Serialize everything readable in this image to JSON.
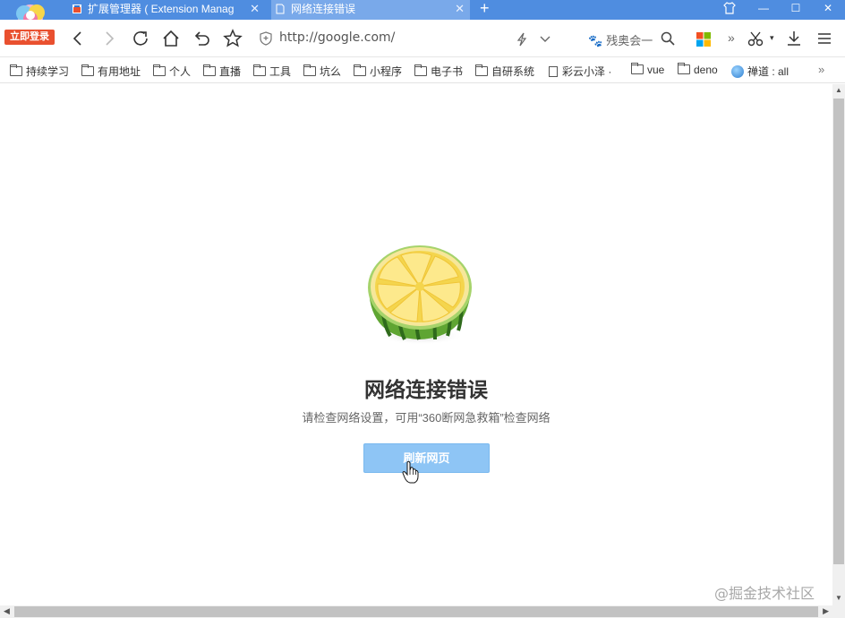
{
  "browser": {
    "login_badge": "立即登录",
    "tabs": [
      {
        "label": "扩展管理器 ( Extension Manag",
        "close": "✕"
      },
      {
        "label": "网络连接错误",
        "close": "✕"
      }
    ],
    "new_tab": "+",
    "window_buttons": {
      "minimize": "—",
      "maximize": "☐",
      "close": "✕"
    }
  },
  "navbar": {
    "address": "http://google.com/",
    "search_engine_text": "残奥会一",
    "more": "»",
    "scissors_drop": "▾"
  },
  "bookmarks": {
    "items": [
      {
        "label": "持续学习",
        "icon": "folder-icon"
      },
      {
        "label": "有用地址",
        "icon": "folder-icon"
      },
      {
        "label": "个人",
        "icon": "folder-icon"
      },
      {
        "label": "直播",
        "icon": "folder-icon"
      },
      {
        "label": "工具",
        "icon": "folder-icon"
      },
      {
        "label": "坑么",
        "icon": "folder-icon"
      },
      {
        "label": "小程序",
        "icon": "folder-icon"
      },
      {
        "label": "电子书",
        "icon": "folder-icon"
      },
      {
        "label": "自研系统",
        "icon": "folder-icon"
      },
      {
        "label": "彩云小泽 ·",
        "icon": "page-icon"
      },
      {
        "label": "vue",
        "icon": "folder-icon"
      },
      {
        "label": "deno",
        "icon": "folder-icon"
      },
      {
        "label": "禅道 : all",
        "icon": "globe-icon"
      }
    ],
    "more": "»"
  },
  "error_page": {
    "title": "网络连接错误",
    "description": "请检查网络设置，可用“360断网急救箱”检查网络",
    "refresh_button": "刷新网页"
  },
  "watermark": "@掘金技术社区",
  "colors": {
    "titlebar": "#4f8de0",
    "active_tab": "#79a9ea",
    "login_badge": "#e9502f",
    "refresh_button": "#8ec5f5"
  }
}
